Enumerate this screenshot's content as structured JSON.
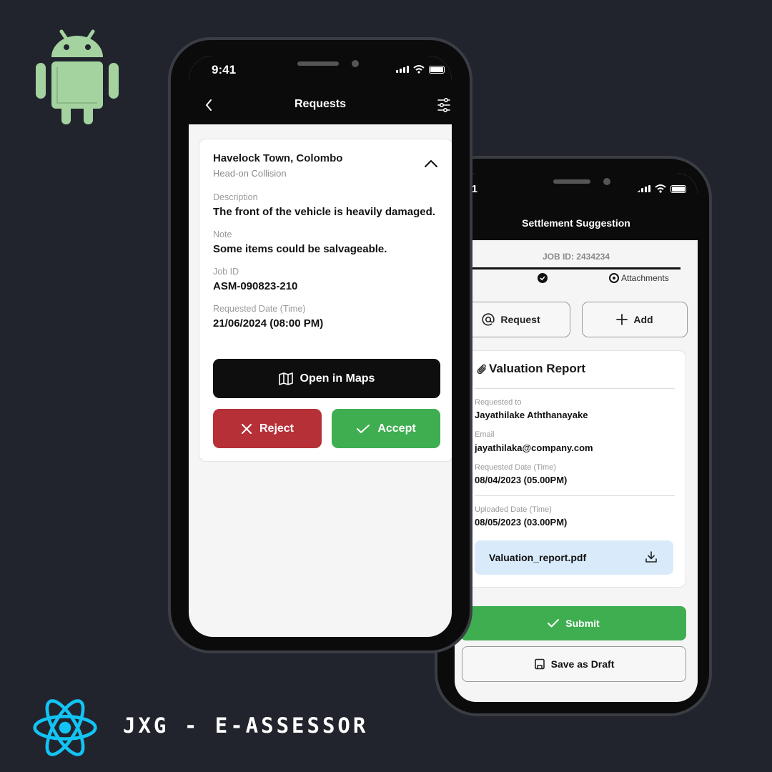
{
  "brand": {
    "name": "JXG - E-ASSESSOR"
  },
  "phone1": {
    "time": "9:41",
    "title": "Requests",
    "location": "Havelock Town, Colombo",
    "incident": "Head-on Collision",
    "fields": [
      {
        "label": "Description",
        "value": "The front of the vehicle is heavily damaged."
      },
      {
        "label": "Note",
        "value": "Some items could be salvageable."
      },
      {
        "label": "Job ID",
        "value": "ASM-090823-210"
      },
      {
        "label": "Requested Date (Time)",
        "value": "21/06/2024 (08:00 PM)"
      }
    ],
    "maps_label": "Open in Maps",
    "reject_label": "Reject",
    "accept_label": "Accept",
    "colors": {
      "reject": "#b53137",
      "accept": "#3eae50"
    }
  },
  "phone2": {
    "time": "9:41",
    "title": "Settlement Suggestion",
    "job_id": "JOB ID: 2434234",
    "step_label": "Attachments",
    "request_label": "Request",
    "add_label": "Add",
    "report_title": "Valuation Report",
    "fields": [
      {
        "label": "Requested to",
        "value": "Jayathilake Aththanayake"
      },
      {
        "label": "Email",
        "value": "jayathilaka@company.com"
      },
      {
        "label": "Requested Date (Time)",
        "value": "08/04/2023 (05.00PM)"
      },
      {
        "label": "Uploaded Date (Time)",
        "value": "08/05/2023 (03.00PM)"
      }
    ],
    "file_name": "Valuation_report.pdf",
    "submit_label": "Submit",
    "draft_label": "Save as Draft"
  }
}
